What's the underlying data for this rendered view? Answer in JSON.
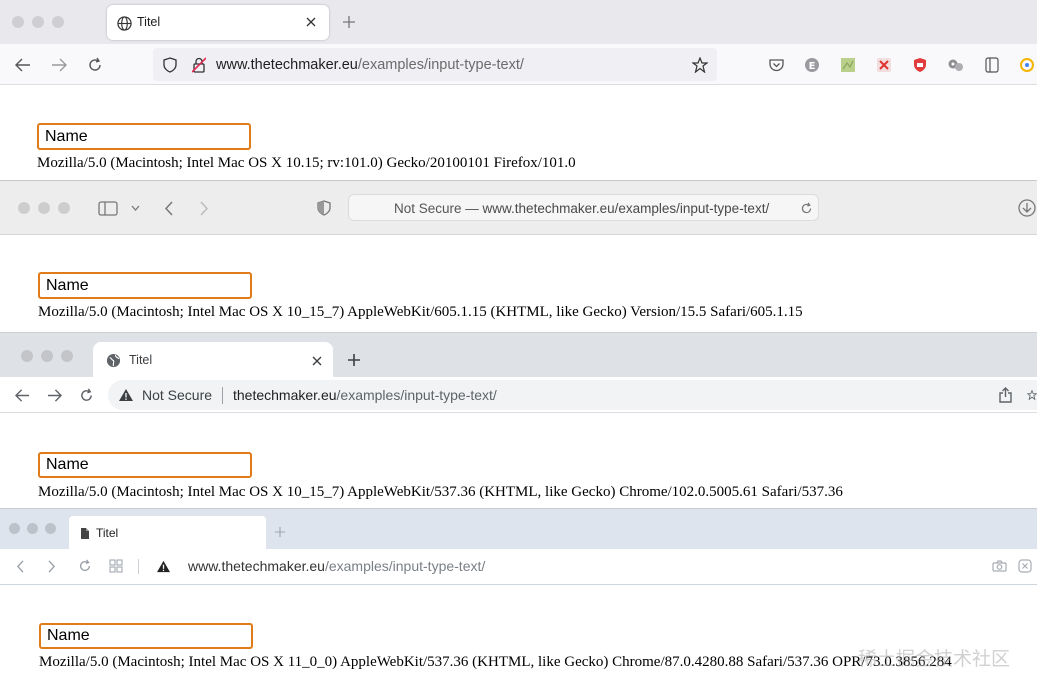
{
  "firefox": {
    "tab_title": "Titel",
    "url_domain": "www.thetechmaker.eu",
    "url_path": "/examples/input-type-text/",
    "field_placeholder": "Name",
    "user_agent": "Mozilla/5.0 (Macintosh; Intel Mac OS X 10.15; rv:101.0) Gecko/20100101 Firefox/101.0"
  },
  "safari": {
    "url_prefix": "Not Secure — ",
    "url_domain": "www.thetechmaker.eu",
    "url_path": "/examples/input-type-text/",
    "field_placeholder": "Name",
    "user_agent": "Mozilla/5.0 (Macintosh; Intel Mac OS X 10_15_7) AppleWebKit/605.1.15 (KHTML, like Gecko) Version/15.5 Safari/605.1.15"
  },
  "chrome": {
    "tab_title": "Titel",
    "security_label": "Not Secure",
    "url_domain": "thetechmaker.eu",
    "url_path": "/examples/input-type-text/",
    "field_placeholder": "Name",
    "user_agent": "Mozilla/5.0 (Macintosh; Intel Mac OS X 10_15_7) AppleWebKit/537.36 (KHTML, like Gecko) Chrome/102.0.5005.61 Safari/537.36"
  },
  "opera": {
    "tab_title": "Titel",
    "url_domain": "www.thetechmaker.eu",
    "url_path": "/examples/input-type-text/",
    "field_placeholder": "Name",
    "user_agent": "Mozilla/5.0 (Macintosh; Intel Mac OS X 11_0_0) AppleWebKit/537.36 (KHTML, like Gecko) Chrome/87.0.4280.88 Safari/537.36 OPR/73.0.3856.284",
    "watermark": "稀土掘金技术社区"
  },
  "colors": {
    "field_border": "#e07b1a",
    "page_bg": "#ffffff"
  }
}
